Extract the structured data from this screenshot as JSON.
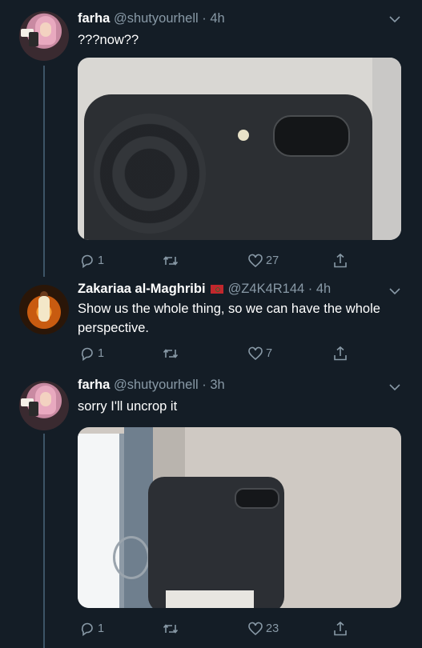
{
  "tweets": [
    {
      "name": "farha",
      "handle": "@shutyourhell",
      "time": "· 4h",
      "text": "???now??",
      "has_media": true,
      "replies": "1",
      "retweets": "",
      "likes": "27"
    },
    {
      "name": "Zakariaa al-Maghribi",
      "flag": "morocco-flag-icon",
      "handle": "@Z4K4R144",
      "time": "· 4h",
      "text": "Show us the whole thing, so we can have the whole perspective.",
      "has_media": false,
      "replies": "1",
      "retweets": "",
      "likes": "7"
    },
    {
      "name": "farha",
      "handle": "@shutyourhell",
      "time": "· 3h",
      "text": "sorry I'll uncrop it",
      "has_media": true,
      "replies": "1",
      "retweets": "",
      "likes": "23"
    }
  ],
  "colors": {
    "background": "#141d26",
    "secondary_text": "#8899a6",
    "thread_line": "#3d5466"
  }
}
